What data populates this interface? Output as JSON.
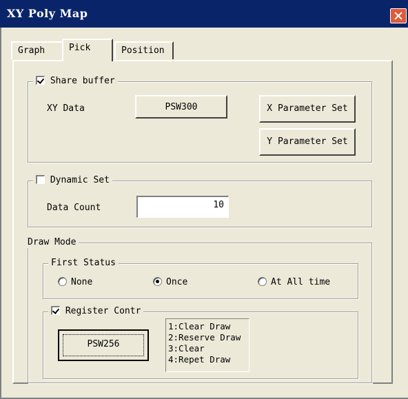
{
  "window": {
    "title": "XY Poly Map"
  },
  "tabs": [
    {
      "label": "Graph"
    },
    {
      "label": "Pick"
    },
    {
      "label": "Position"
    }
  ],
  "share_buffer": {
    "checkbox_label": "Share buffer",
    "checked": true,
    "xy_data_label": "XY Data",
    "xy_data_button": "PSW300",
    "param_set_1": "X Parameter Set",
    "param_set_2": "Y Parameter Set"
  },
  "dynamic_set": {
    "checkbox_label": "Dynamic Set",
    "checked": false,
    "data_count_label": "Data Count",
    "data_count_value": "10"
  },
  "draw_mode": {
    "label": "Draw Mode",
    "first_status": {
      "label": "First Status",
      "options": [
        "None",
        "Once",
        "At All time"
      ],
      "selected": "Once"
    },
    "register_control": {
      "checkbox_label": "Register Contr",
      "checked": true,
      "button": "PSW256",
      "list_items": [
        "1:Clear Draw",
        "2:Reserve Draw",
        "3:Clear",
        "4:Repet Draw"
      ]
    }
  },
  "colors": {
    "titlebar": "#0a246a",
    "dialog_bg": "#ece9d8",
    "close_button": "#e05a3a"
  }
}
